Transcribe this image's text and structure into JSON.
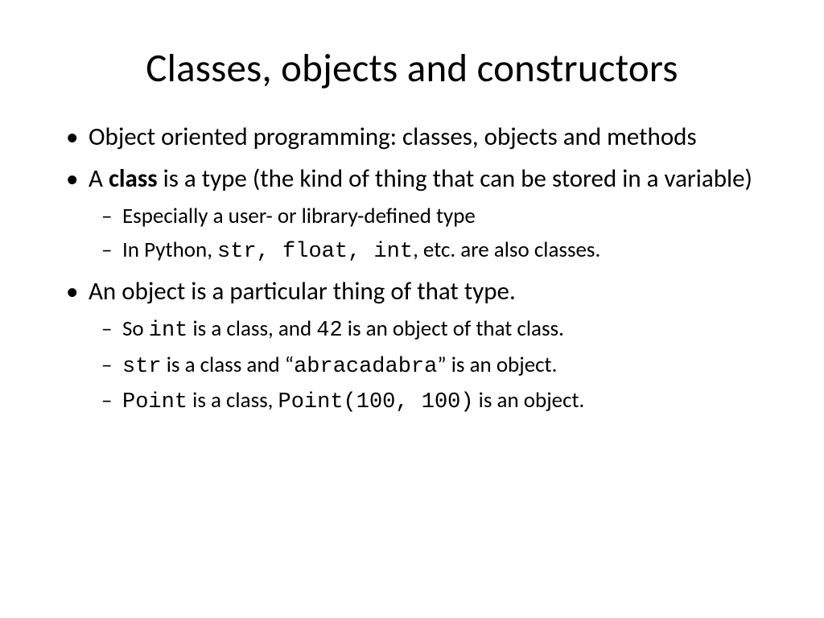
{
  "title": "Classes, objects and constructors",
  "b1": "Object oriented programming:  classes, objects and methods",
  "b2_pre": "A ",
  "b2_bold": "class",
  "b2_post": " is a type (the kind of thing that can be stored in a  variable)",
  "b2s1": "Especially a user- or library-defined type",
  "b2s2_pre": "In Python, ",
  "b2s2_code": "str, float, int",
  "b2s2_post": ", etc. are also classes.",
  "b3": "An object is a particular thing of that type.",
  "b3s1_pre": "So ",
  "b3s1_c1": "int",
  "b3s1_mid": " is a class, and ",
  "b3s1_c2": "42",
  "b3s1_post": " is an object of that class.",
  "b3s2_c1": "str",
  "b3s2_mid": " is a class and “",
  "b3s2_c2": "abracadabra",
  "b3s2_post": "”  is an object.",
  "b3s3_c1": "Point",
  "b3s3_mid": " is a class, ",
  "b3s3_c2": "Point(100, 100)",
  "b3s3_post": " is an object."
}
